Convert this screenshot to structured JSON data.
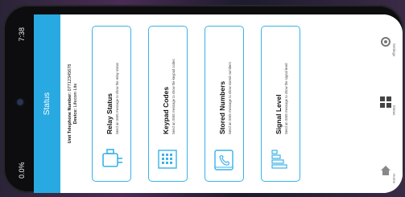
{
  "device": {
    "status_left": "0.0%",
    "status_right": "7:38"
  },
  "header": {
    "title": "Status"
  },
  "unit": {
    "phone_label": "Unit Telephone Number:",
    "phone_value": "07712345678",
    "device_label": "Device:",
    "device_value": "Lifecom Lite"
  },
  "cards": [
    {
      "title": "Relay Status",
      "desc": "Send an SMS message to show the relay status",
      "icon": "plug-icon"
    },
    {
      "title": "Keypad Codes",
      "desc": "Send an SMS message to show the keypad codes",
      "icon": "keypad-building-icon"
    },
    {
      "title": "Stored Numbers",
      "desc": "Send an SMS message to show stored numbers",
      "icon": "phonebook-icon"
    },
    {
      "title": "Signal Level",
      "desc": "Send an SMS message to show the signal level",
      "icon": "signal-bars-icon"
    }
  ],
  "nav": {
    "settings": "Settings",
    "status": "Status",
    "home": "Home"
  },
  "colors": {
    "accent": "#29a9e1",
    "card_border": "#3ab2e6"
  }
}
